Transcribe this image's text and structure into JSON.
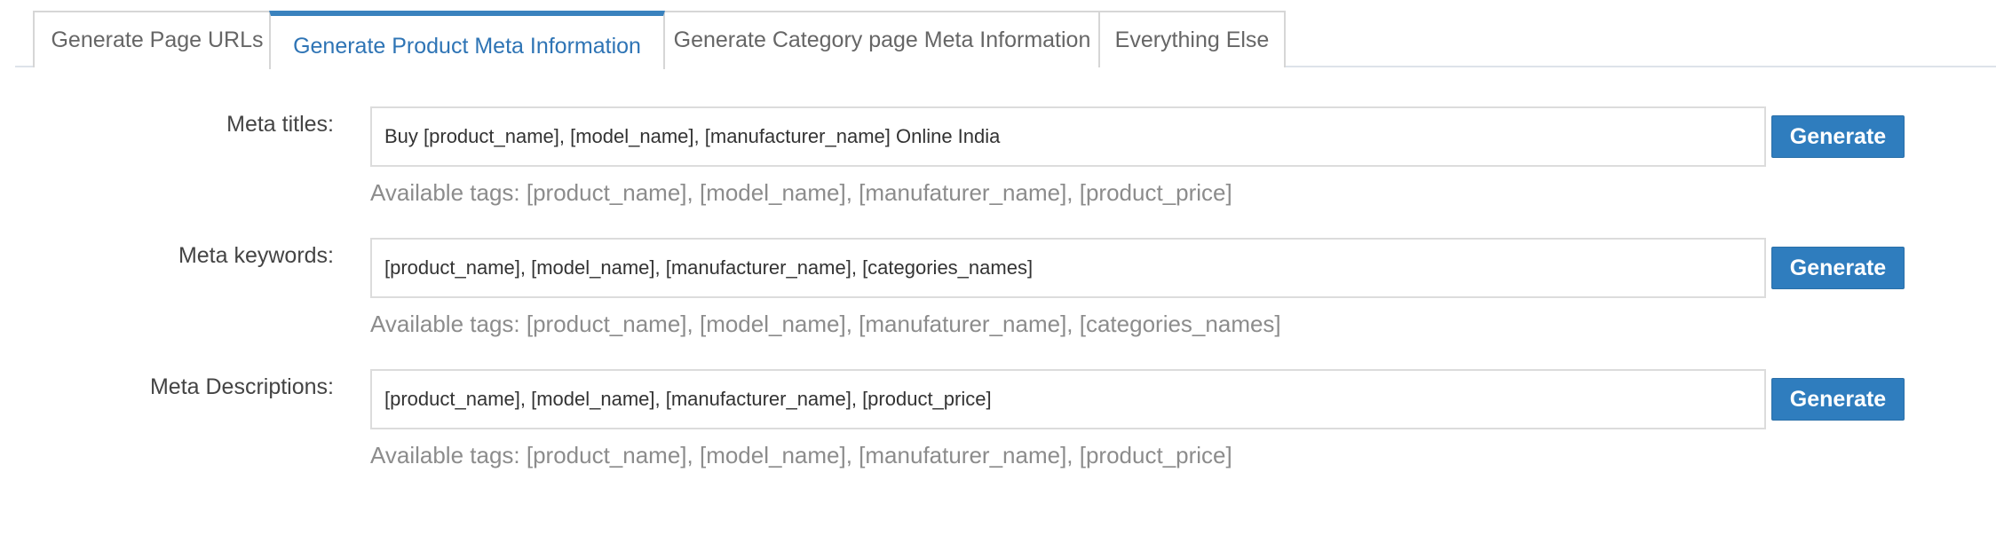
{
  "tabs": [
    {
      "label": "Generate Page URLs",
      "active": false
    },
    {
      "label": "Generate Product Meta Information",
      "active": true
    },
    {
      "label": "Generate Category page Meta Information",
      "active": false
    },
    {
      "label": "Everything Else",
      "active": false
    }
  ],
  "form": {
    "meta_titles": {
      "label": "Meta titles:",
      "value": "Buy [product_name], [model_name], [manufacturer_name] Online India",
      "button": "Generate",
      "hint": "Available tags: [product_name], [model_name], [manufaturer_name], [product_price]"
    },
    "meta_keywords": {
      "label": "Meta keywords:",
      "value": "[product_name], [model_name], [manufacturer_name], [categories_names]",
      "button": "Generate",
      "hint": "Available tags: [product_name], [model_name], [manufaturer_name], [categories_names]"
    },
    "meta_descriptions": {
      "label": "Meta Descriptions:",
      "value": "[product_name], [model_name], [manufacturer_name], [product_price]",
      "button": "Generate",
      "hint": "Available tags: [product_name], [model_name], [manufaturer_name], [product_price]"
    }
  },
  "colors": {
    "accent": "#2f7dbe",
    "active_tab_text": "#2e74b5",
    "hint_text": "#8c8c8c"
  }
}
